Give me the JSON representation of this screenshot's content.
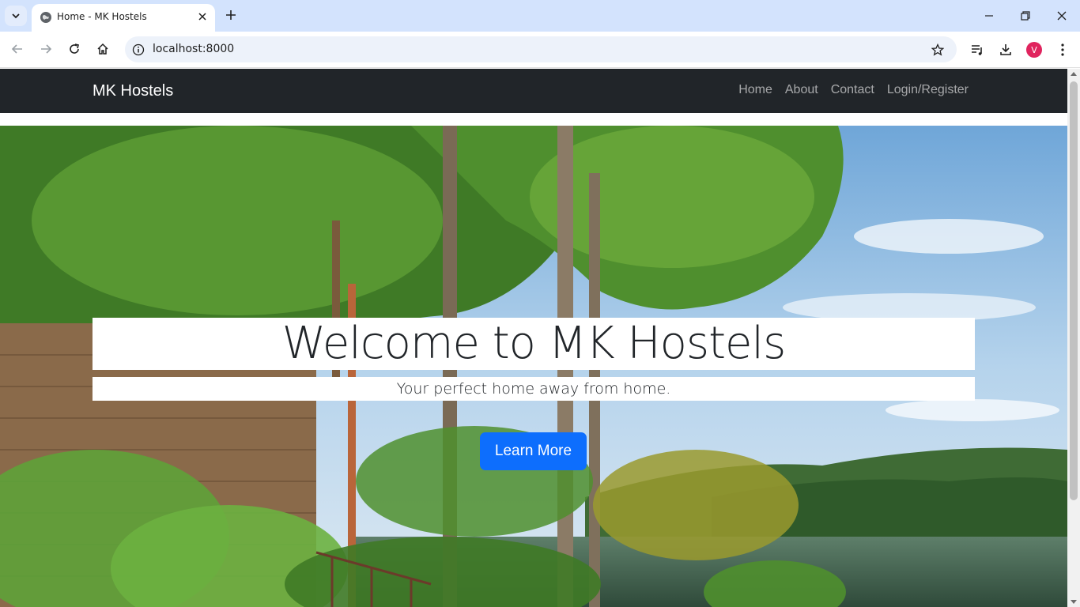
{
  "browser": {
    "tab_title": "Home - MK Hostels",
    "url": "localhost:8000",
    "profile_initial": "V"
  },
  "site": {
    "brand": "MK Hostels",
    "nav": [
      "Home",
      "About",
      "Contact",
      "Login/Register"
    ]
  },
  "hero": {
    "title": "Welcome to MK Hostels",
    "subtitle": "Your perfect home away from home.",
    "button_label": "Learn More",
    "image_description": ""
  },
  "colors": {
    "navbar_bg": "#212529",
    "button_bg": "#0d6efd",
    "tabstrip_bg": "#d3e3fd"
  }
}
